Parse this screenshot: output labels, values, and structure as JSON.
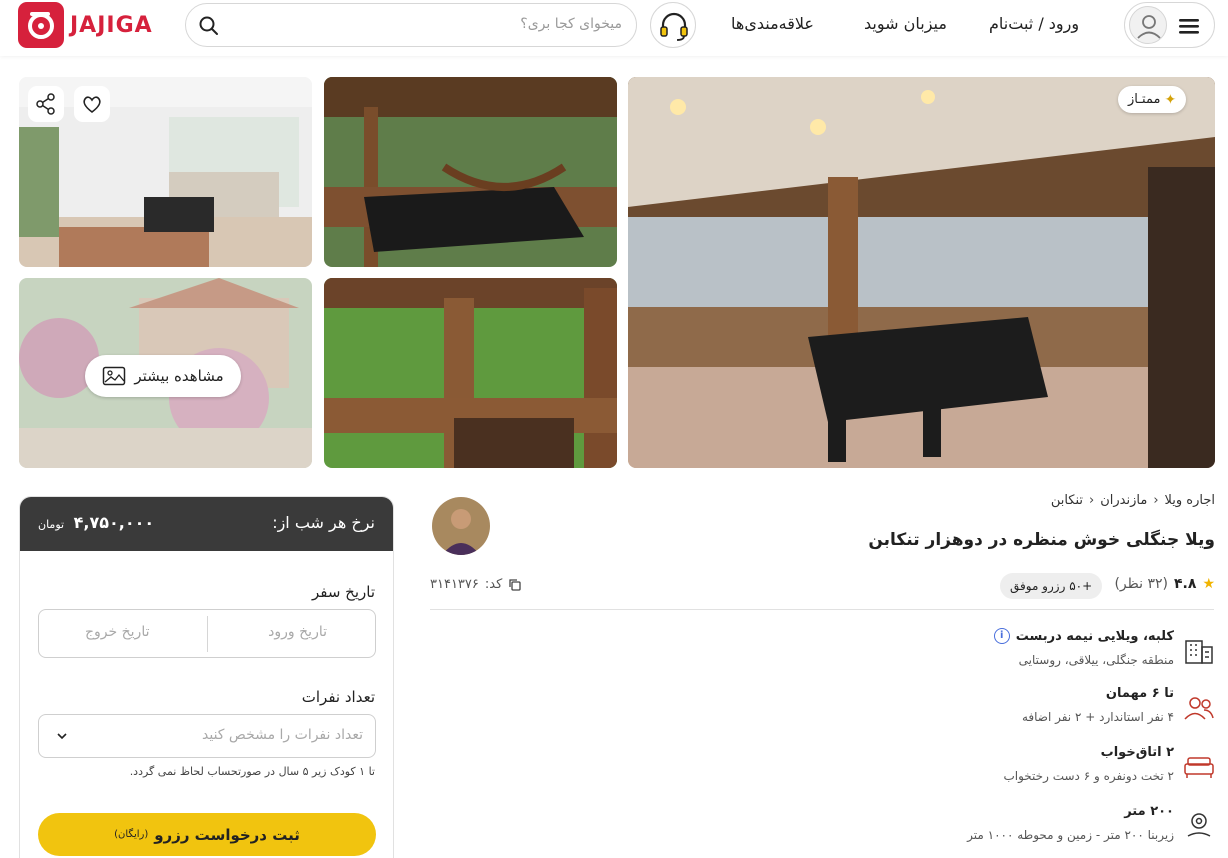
{
  "header": {
    "logo_text": "JAJIGA",
    "search_placeholder": "میخوای کجا بری؟",
    "nav": {
      "favorites": "علاقه‌مندی‌ها",
      "host": "میزبان شوید",
      "login": "ورود / ثبت‌نام"
    }
  },
  "gallery": {
    "badge": "ممتـاز",
    "more_photos": "مشاهده بیشتر"
  },
  "booking": {
    "price_title": "نرخ هر شب از:",
    "price": "۴,۷۵۰,۰۰۰",
    "currency": "تومان",
    "date_label": "تاریخ سفر",
    "checkin_placeholder": "تاریخ ورود",
    "checkout_placeholder": "تاریخ خروج",
    "guests_label": "تعداد نفرات",
    "guests_placeholder": "تعداد نفرات را مشخص کنید",
    "note": "تا ۱ کودک زیر ۵ سال در صورتحساب لحاظ نمی گردد.",
    "reserve_label": "ثبت درخواست رزرو",
    "reserve_free": "(رایگان)"
  },
  "listing": {
    "breadcrumb": [
      "اجاره ویلا",
      "مازندران",
      "تنکابن"
    ],
    "title": "ویلا جنگلی خوش منظره در دوهزار تنکابن",
    "rating": "۴.۸",
    "reviews": "(۳۲ نظر)",
    "bookings_pill": "+۵۰ رزرو موفق",
    "code_label": "کد:",
    "code": "۳۱۴۱۳۷۶",
    "features": [
      {
        "title": "کلبه، ویلایی نیمه دربست",
        "subtitle": "منطقه جنگلی، ییلاقی، روستایی",
        "icon": "building-icon"
      },
      {
        "title": "تا ۶ مهمان",
        "subtitle": "۴ نفر استاندارد + ۲ نفر اضافه",
        "icon": "users-icon"
      },
      {
        "title": "۲ اتاق‌خواب",
        "subtitle": "۲ تخت دونفره و ۶ دست رختخواب",
        "icon": "bed-icon"
      },
      {
        "title": "۲۰۰ متر",
        "subtitle": "زیربنا ۲۰۰ متر - زمین و محوطه ۱۰۰۰ متر",
        "icon": "area-icon"
      }
    ]
  },
  "colors": {
    "brand": "#d6213c",
    "reserve_button": "#f1c40f",
    "card_header": "#3a3a3a"
  }
}
